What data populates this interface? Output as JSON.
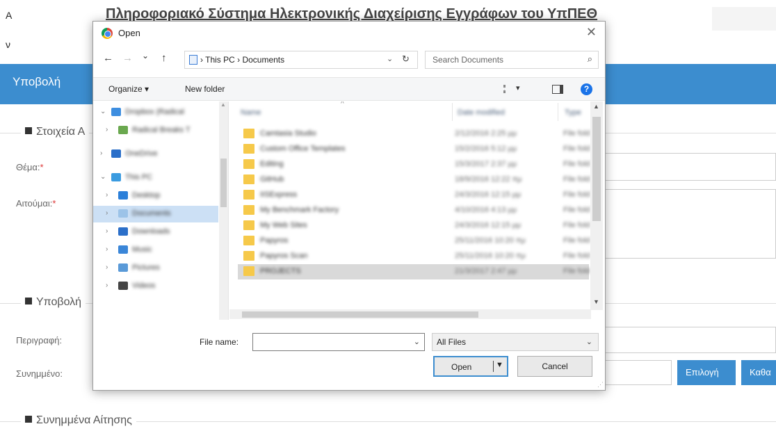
{
  "page": {
    "header_left_top": "Α",
    "header_left_bottom": "ν",
    "site_title": "Πληροφοριακό Σύστημα Ηλεκτρονικής Διαχείρισης Εγγράφων του ΥπΠΕΘ",
    "nav_title": "Υποβολή",
    "section1_legend": "Στοιχεία Α",
    "subject_label": "Θέμα:",
    "request_label": "Αιτούμαι:",
    "required_mark": "*",
    "section2_legend": "Υποβολή",
    "description_label": "Περιγραφή:",
    "attachment_label": "Συνημμένο:",
    "choose_button": "Επιλογή",
    "clear_button": "Καθα",
    "section3_legend": "Συνημμένα Αίτησης"
  },
  "dialog": {
    "title": "Open",
    "close_glyph": "✕",
    "back_glyph": "←",
    "forward_glyph": "→",
    "recent_glyph": "⌄",
    "up_glyph": "↑",
    "breadcrumb": "› This PC › Documents",
    "search_placeholder": "Search Documents",
    "organize": "Organize ▾",
    "new_folder": "New folder",
    "help_glyph": "?",
    "nav_items": [
      {
        "label": "Dropbox (Radical"
      },
      {
        "label": "Radical Breaks T"
      },
      {
        "label": "OneDrive"
      },
      {
        "label": "This PC"
      },
      {
        "label": "Desktop"
      },
      {
        "label": "Documents"
      },
      {
        "label": "Downloads"
      },
      {
        "label": "Music"
      },
      {
        "label": "Pictures"
      },
      {
        "label": "Videos"
      }
    ],
    "columns": {
      "name": "Name",
      "date": "Date modified",
      "type": "Type"
    },
    "files": [
      {
        "name": "Camtasia Studio",
        "date": "2/12/2016 2:25 μμ",
        "type": "File fold"
      },
      {
        "name": "Custom Office Templates",
        "date": "15/2/2016 5:12 μμ",
        "type": "File fold"
      },
      {
        "name": "Editing",
        "date": "15/3/2017 2:37 μμ",
        "type": "File fold"
      },
      {
        "name": "GitHub",
        "date": "18/9/2016 12:22 πμ",
        "type": "File fold"
      },
      {
        "name": "IISExpress",
        "date": "24/3/2016 12:15 μμ",
        "type": "File fold"
      },
      {
        "name": "My Benchmark Factory",
        "date": "4/10/2016 4:13 μμ",
        "type": "File fold"
      },
      {
        "name": "My Web Sites",
        "date": "24/3/2016 12:15 μμ",
        "type": "File fold"
      },
      {
        "name": "Papyros",
        "date": "25/11/2016 10:20 πμ",
        "type": "File fold"
      },
      {
        "name": "Papyros Scan",
        "date": "25/11/2016 10:20 πμ",
        "type": "File fold"
      },
      {
        "name": "PROJECTS",
        "date": "21/3/2017 2:47 μμ",
        "type": "File fold"
      }
    ],
    "file_name_label": "File name:",
    "file_name_value": "",
    "file_type": "All Files",
    "open_button": "Open",
    "cancel_button": "Cancel"
  },
  "colors": {
    "accent": "#3c8dcf",
    "folder": "#f6c94a",
    "selection": "#cce0f5"
  }
}
